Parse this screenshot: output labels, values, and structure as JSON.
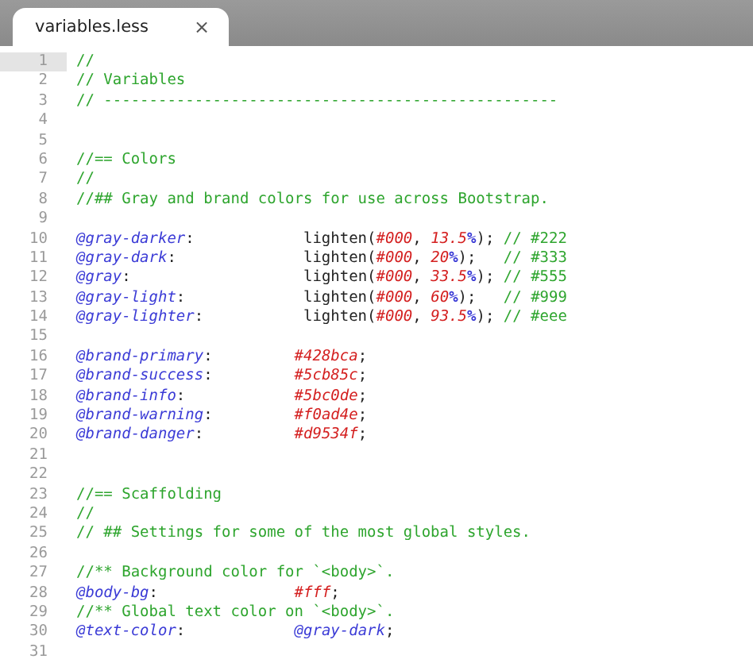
{
  "tabs": [
    {
      "title": "variables.less",
      "close": "×",
      "selected": true
    }
  ],
  "lines": [
    {
      "number": "1",
      "selected": true,
      "tokens": [
        {
          "kind": "comment",
          "text": "//"
        }
      ]
    },
    {
      "number": "2",
      "selected": false,
      "tokens": [
        {
          "kind": "comment",
          "text": "// Variables"
        }
      ]
    },
    {
      "number": "3",
      "selected": false,
      "tokens": [
        {
          "kind": "comment",
          "text": "// --------------------------------------------------"
        }
      ]
    },
    {
      "number": "4",
      "selected": false
    },
    {
      "number": "5",
      "selected": false
    },
    {
      "number": "6",
      "selected": false,
      "tokens": [
        {
          "kind": "comment",
          "text": "//== Colors"
        }
      ]
    },
    {
      "number": "7",
      "selected": false,
      "tokens": [
        {
          "kind": "comment",
          "text": "//"
        }
      ]
    },
    {
      "number": "8",
      "selected": false,
      "tokens": [
        {
          "kind": "comment",
          "text": "//## Gray and brand colors for use across Bootstrap."
        }
      ]
    },
    {
      "number": "9",
      "selected": false
    },
    {
      "number": "10",
      "selected": false,
      "tokens": [
        {
          "kind": "variable",
          "text": "@gray-darker"
        },
        {
          "kind": "plain",
          "text": ":            lighten("
        },
        {
          "kind": "literal",
          "text": "#000"
        },
        {
          "kind": "plain",
          "text": ", "
        },
        {
          "kind": "literal",
          "text": "13.5"
        },
        {
          "kind": "unit",
          "text": "%"
        },
        {
          "kind": "plain",
          "text": "); "
        },
        {
          "kind": "comment",
          "text": "// #222"
        }
      ]
    },
    {
      "number": "11",
      "selected": false,
      "tokens": [
        {
          "kind": "variable",
          "text": "@gray-dark"
        },
        {
          "kind": "plain",
          "text": ":              lighten("
        },
        {
          "kind": "literal",
          "text": "#000"
        },
        {
          "kind": "plain",
          "text": ", "
        },
        {
          "kind": "literal",
          "text": "20"
        },
        {
          "kind": "unit",
          "text": "%"
        },
        {
          "kind": "plain",
          "text": ");   "
        },
        {
          "kind": "comment",
          "text": "// #333"
        }
      ]
    },
    {
      "number": "12",
      "selected": false,
      "tokens": [
        {
          "kind": "variable",
          "text": "@gray"
        },
        {
          "kind": "plain",
          "text": ":                   lighten("
        },
        {
          "kind": "literal",
          "text": "#000"
        },
        {
          "kind": "plain",
          "text": ", "
        },
        {
          "kind": "literal",
          "text": "33.5"
        },
        {
          "kind": "unit",
          "text": "%"
        },
        {
          "kind": "plain",
          "text": "); "
        },
        {
          "kind": "comment",
          "text": "// #555"
        }
      ]
    },
    {
      "number": "13",
      "selected": false,
      "tokens": [
        {
          "kind": "variable",
          "text": "@gray-light"
        },
        {
          "kind": "plain",
          "text": ":             lighten("
        },
        {
          "kind": "literal",
          "text": "#000"
        },
        {
          "kind": "plain",
          "text": ", "
        },
        {
          "kind": "literal",
          "text": "60"
        },
        {
          "kind": "unit",
          "text": "%"
        },
        {
          "kind": "plain",
          "text": ");   "
        },
        {
          "kind": "comment",
          "text": "// #999"
        }
      ]
    },
    {
      "number": "14",
      "selected": false,
      "tokens": [
        {
          "kind": "variable",
          "text": "@gray-lighter"
        },
        {
          "kind": "plain",
          "text": ":           lighten("
        },
        {
          "kind": "literal",
          "text": "#000"
        },
        {
          "kind": "plain",
          "text": ", "
        },
        {
          "kind": "literal",
          "text": "93.5"
        },
        {
          "kind": "unit",
          "text": "%"
        },
        {
          "kind": "plain",
          "text": "); "
        },
        {
          "kind": "comment",
          "text": "// #eee"
        }
      ]
    },
    {
      "number": "15",
      "selected": false
    },
    {
      "number": "16",
      "selected": false,
      "tokens": [
        {
          "kind": "variable",
          "text": "@brand-primary"
        },
        {
          "kind": "plain",
          "text": ":         "
        },
        {
          "kind": "literal",
          "text": "#428bca"
        },
        {
          "kind": "plain",
          "text": ";"
        }
      ]
    },
    {
      "number": "17",
      "selected": false,
      "tokens": [
        {
          "kind": "variable",
          "text": "@brand-success"
        },
        {
          "kind": "plain",
          "text": ":         "
        },
        {
          "kind": "literal",
          "text": "#5cb85c"
        },
        {
          "kind": "plain",
          "text": ";"
        }
      ]
    },
    {
      "number": "18",
      "selected": false,
      "tokens": [
        {
          "kind": "variable",
          "text": "@brand-info"
        },
        {
          "kind": "plain",
          "text": ":            "
        },
        {
          "kind": "literal",
          "text": "#5bc0de"
        },
        {
          "kind": "plain",
          "text": ";"
        }
      ]
    },
    {
      "number": "19",
      "selected": false,
      "tokens": [
        {
          "kind": "variable",
          "text": "@brand-warning"
        },
        {
          "kind": "plain",
          "text": ":         "
        },
        {
          "kind": "literal",
          "text": "#f0ad4e"
        },
        {
          "kind": "plain",
          "text": ";"
        }
      ]
    },
    {
      "number": "20",
      "selected": false,
      "tokens": [
        {
          "kind": "variable",
          "text": "@brand-danger"
        },
        {
          "kind": "plain",
          "text": ":          "
        },
        {
          "kind": "literal",
          "text": "#d9534f"
        },
        {
          "kind": "plain",
          "text": ";"
        }
      ]
    },
    {
      "number": "21",
      "selected": false
    },
    {
      "number": "22",
      "selected": false
    },
    {
      "number": "23",
      "selected": false,
      "tokens": [
        {
          "kind": "comment",
          "text": "//== Scaffolding"
        }
      ]
    },
    {
      "number": "24",
      "selected": false,
      "tokens": [
        {
          "kind": "comment",
          "text": "//"
        }
      ]
    },
    {
      "number": "25",
      "selected": false,
      "tokens": [
        {
          "kind": "comment",
          "text": "// ## Settings for some of the most global styles."
        }
      ]
    },
    {
      "number": "26",
      "selected": false
    },
    {
      "number": "27",
      "selected": false,
      "tokens": [
        {
          "kind": "comment",
          "text": "//** Background color for `<body>`."
        }
      ]
    },
    {
      "number": "28",
      "selected": false,
      "tokens": [
        {
          "kind": "variable",
          "text": "@body-bg"
        },
        {
          "kind": "plain",
          "text": ":               "
        },
        {
          "kind": "literal",
          "text": "#fff"
        },
        {
          "kind": "plain",
          "text": ";"
        }
      ]
    },
    {
      "number": "29",
      "selected": false,
      "tokens": [
        {
          "kind": "comment",
          "text": "//** Global text color on `<body>`."
        }
      ]
    },
    {
      "number": "30",
      "selected": false,
      "tokens": [
        {
          "kind": "variable",
          "text": "@text-color"
        },
        {
          "kind": "plain",
          "text": ":            "
        },
        {
          "kind": "variable",
          "text": "@gray-dark"
        },
        {
          "kind": "plain",
          "text": ";"
        }
      ]
    },
    {
      "number": "31",
      "selected": false
    }
  ]
}
